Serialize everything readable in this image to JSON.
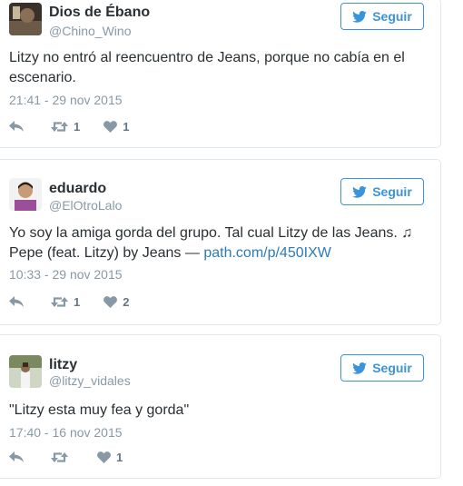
{
  "colors": {
    "accent": "#3b94d9",
    "link": "#2b7bb9",
    "muted": "#8899a6",
    "text": "#292f33",
    "border": "#e1e8ed"
  },
  "tweets": [
    {
      "name": "Dios de Ébano",
      "handle": "@Chino_Wino",
      "follow_label": "Seguir",
      "text": "Litzy no entró al reencuentro de Jeans, porque no cabía en el escenario.",
      "link": "",
      "timestamp": "21:41 - 29 nov 2015",
      "retweets": "1",
      "likes": "1",
      "icons": {
        "reply": "reply-icon",
        "retweet": "retweet-icon",
        "like": "heart-icon",
        "follow": "bird-icon"
      }
    },
    {
      "name": "eduardo",
      "handle": "@ElOtroLalo",
      "follow_label": "Seguir",
      "text": "Yo soy la amiga gorda del grupo. Tal cual Litzy de las Jeans. ♫ Pepe (feat. Litzy) by Jeans — ",
      "link": "path.com/p/450IXW",
      "timestamp": "10:33 - 29 nov 2015",
      "retweets": "1",
      "likes": "2",
      "icons": {
        "reply": "reply-icon",
        "retweet": "retweet-icon",
        "like": "heart-icon",
        "follow": "bird-icon"
      }
    },
    {
      "name": "litzy",
      "handle": "@litzy_vidales",
      "follow_label": "Seguir",
      "text": "\"Litzy esta muy fea y gorda\"",
      "link": "",
      "timestamp": "17:40 - 16 nov 2015",
      "retweets": "",
      "likes": "1",
      "icons": {
        "reply": "reply-icon",
        "retweet": "retweet-icon",
        "like": "heart-icon",
        "follow": "bird-icon"
      }
    }
  ]
}
